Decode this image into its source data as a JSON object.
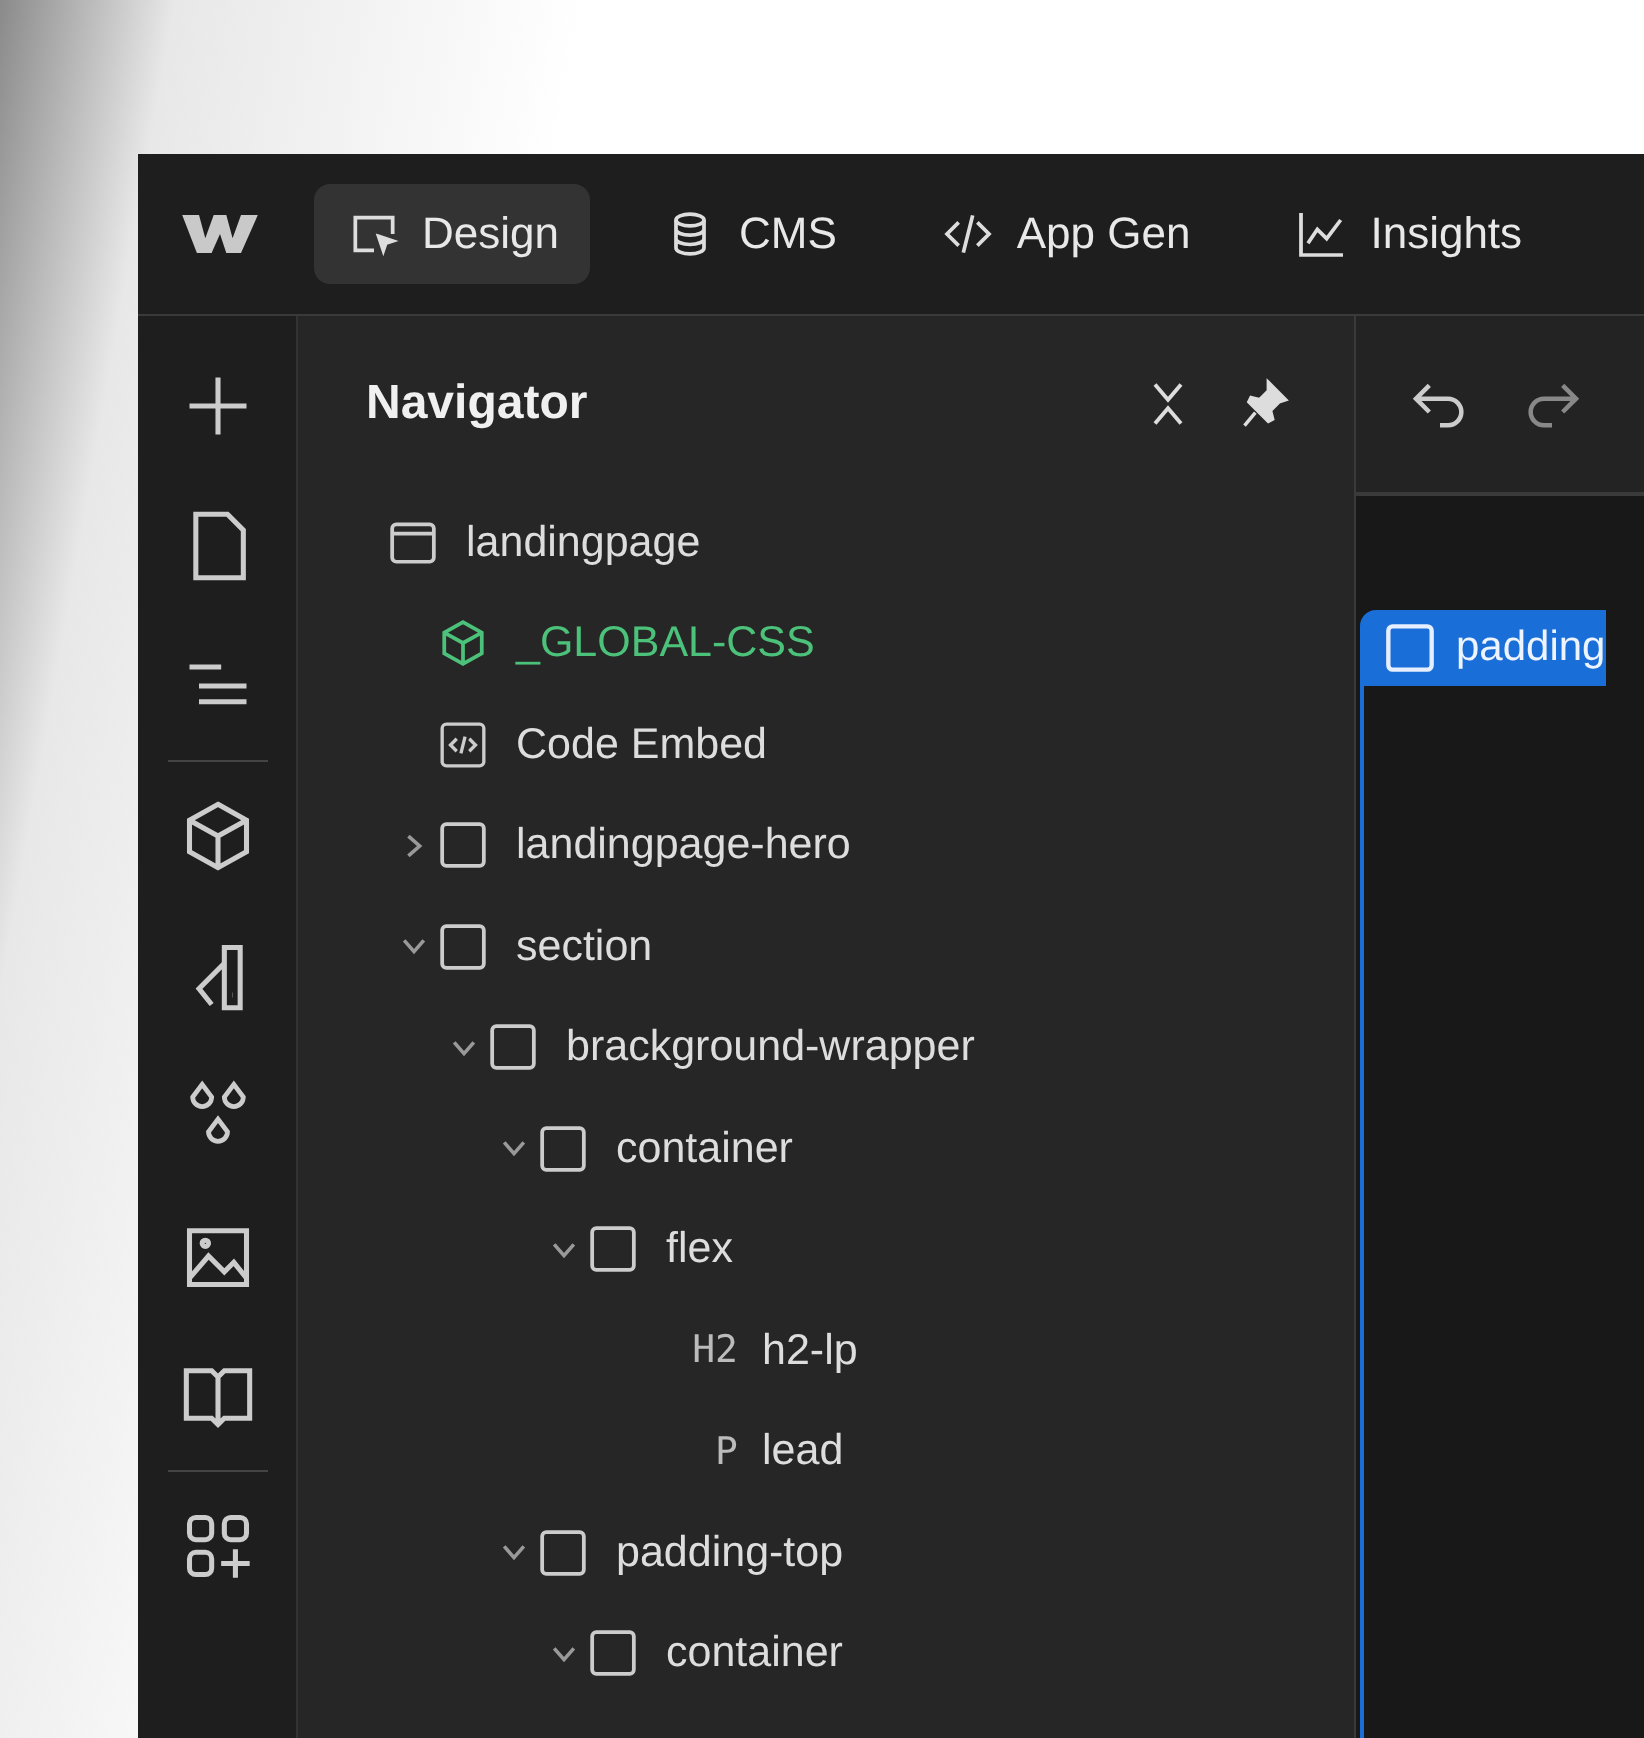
{
  "tabs": [
    {
      "label": "Design",
      "kind": "design",
      "selected": true
    },
    {
      "label": "CMS",
      "kind": "cms",
      "selected": false
    },
    {
      "label": "App Gen",
      "kind": "code",
      "selected": false
    },
    {
      "label": "Insights",
      "kind": "chart",
      "selected": false
    }
  ],
  "navigator": {
    "title": "Navigator",
    "tree": [
      {
        "label": "landingpage",
        "kind": "page",
        "children": [
          {
            "label": "_GLOBAL-CSS",
            "kind": "component"
          },
          {
            "label": "Code Embed",
            "kind": "embed"
          },
          {
            "label": "landingpage-hero",
            "kind": "element",
            "expanded": false
          },
          {
            "label": "section",
            "kind": "element",
            "expanded": true,
            "children": [
              {
                "label": "brackground-wrapper",
                "kind": "element",
                "expanded": true,
                "children": [
                  {
                    "label": "container",
                    "kind": "element",
                    "expanded": true,
                    "children": [
                      {
                        "label": "flex",
                        "kind": "element",
                        "expanded": true,
                        "children": [
                          {
                            "label": "h2-lp",
                            "kind": "text",
                            "tag": "H2"
                          },
                          {
                            "label": "lead",
                            "kind": "text",
                            "tag": "P"
                          }
                        ]
                      }
                    ]
                  },
                  {
                    "label": "padding-top",
                    "kind": "element",
                    "expanded": true,
                    "children": [
                      {
                        "label": "container",
                        "kind": "element",
                        "expanded": true
                      }
                    ]
                  }
                ]
              }
            ]
          }
        ]
      }
    ]
  },
  "canvas": {
    "selection_label": "padding"
  }
}
